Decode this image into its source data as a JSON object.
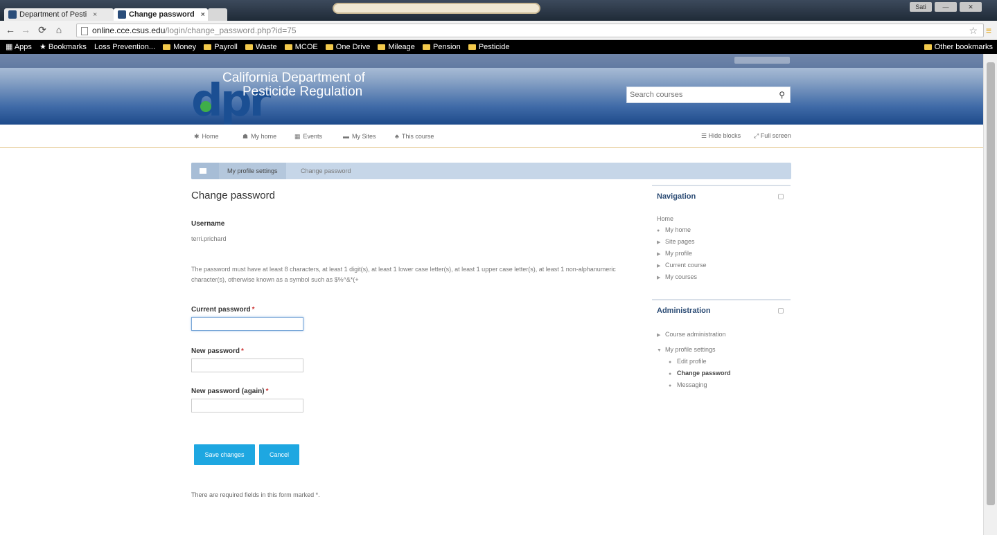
{
  "browser": {
    "tabs": [
      {
        "title": "Department of Pesti",
        "close": "×"
      },
      {
        "title": "Change password",
        "close": "×"
      }
    ],
    "window_controls": [
      "Sati",
      "—",
      "✕"
    ],
    "url": {
      "domain": "online.cce.csus.edu",
      "path": "/login/change_password.php?id=75"
    },
    "bookmarks": [
      "Apps",
      "Bookmarks",
      "Loss Prevention...",
      "Money",
      "Payroll",
      "Waste",
      "MCOE",
      "One Drive",
      "Mileage",
      "Pension",
      "Pesticide"
    ],
    "other_bookmarks": "Other bookmarks"
  },
  "site": {
    "logo_text": "dpr",
    "line1": "California Department of",
    "line2": "Pesticide Regulation",
    "search_placeholder": "Search courses"
  },
  "nav": {
    "items": [
      "Home",
      "My home",
      "Events",
      "My Sites",
      "This course"
    ],
    "hide_blocks": "Hide blocks",
    "full_screen": "Full screen"
  },
  "breadcrumb": [
    "My profile settings",
    "Change password"
  ],
  "main": {
    "title": "Change password",
    "username_label": "Username",
    "username_value": "terri.prichard",
    "rules": "The password must have at least 8 characters, at least 1 digit(s), at least 1 lower case letter(s), at least 1 upper case letter(s), at least 1 non-alphanumeric character(s), otherwise known as a symbol such as $%^&*(+",
    "current_label": "Current password",
    "new_label": "New password",
    "again_label": "New password (again)",
    "required_mark": "*",
    "save_label": "Save changes",
    "cancel_label": "Cancel",
    "required_note": "There are required fields in this form marked *."
  },
  "navigation_block": {
    "title": "Navigation",
    "home": "Home",
    "items": [
      "My home",
      "Site pages",
      "My profile",
      "Current course",
      "My courses"
    ]
  },
  "admin_block": {
    "title": "Administration",
    "course_admin": "Course administration",
    "profile_settings": "My profile settings",
    "sub_items": [
      "Edit profile",
      "Change password",
      "Messaging"
    ]
  },
  "colors": {
    "banner": "#1d4a8a",
    "button": "#1ea7e1",
    "block_title": "#2b4b74"
  }
}
